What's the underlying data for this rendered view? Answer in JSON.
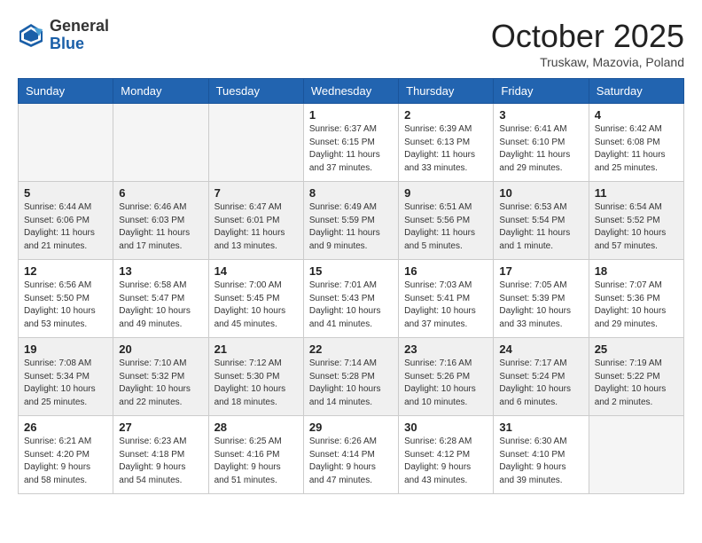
{
  "logo": {
    "general": "General",
    "blue": "Blue"
  },
  "title": "October 2025",
  "subtitle": "Truskaw, Mazovia, Poland",
  "days_of_week": [
    "Sunday",
    "Monday",
    "Tuesday",
    "Wednesday",
    "Thursday",
    "Friday",
    "Saturday"
  ],
  "weeks": [
    [
      {
        "day": "",
        "info": ""
      },
      {
        "day": "",
        "info": ""
      },
      {
        "day": "",
        "info": ""
      },
      {
        "day": "1",
        "info": "Sunrise: 6:37 AM\nSunset: 6:15 PM\nDaylight: 11 hours\nand 37 minutes."
      },
      {
        "day": "2",
        "info": "Sunrise: 6:39 AM\nSunset: 6:13 PM\nDaylight: 11 hours\nand 33 minutes."
      },
      {
        "day": "3",
        "info": "Sunrise: 6:41 AM\nSunset: 6:10 PM\nDaylight: 11 hours\nand 29 minutes."
      },
      {
        "day": "4",
        "info": "Sunrise: 6:42 AM\nSunset: 6:08 PM\nDaylight: 11 hours\nand 25 minutes."
      }
    ],
    [
      {
        "day": "5",
        "info": "Sunrise: 6:44 AM\nSunset: 6:06 PM\nDaylight: 11 hours\nand 21 minutes."
      },
      {
        "day": "6",
        "info": "Sunrise: 6:46 AM\nSunset: 6:03 PM\nDaylight: 11 hours\nand 17 minutes."
      },
      {
        "day": "7",
        "info": "Sunrise: 6:47 AM\nSunset: 6:01 PM\nDaylight: 11 hours\nand 13 minutes."
      },
      {
        "day": "8",
        "info": "Sunrise: 6:49 AM\nSunset: 5:59 PM\nDaylight: 11 hours\nand 9 minutes."
      },
      {
        "day": "9",
        "info": "Sunrise: 6:51 AM\nSunset: 5:56 PM\nDaylight: 11 hours\nand 5 minutes."
      },
      {
        "day": "10",
        "info": "Sunrise: 6:53 AM\nSunset: 5:54 PM\nDaylight: 11 hours\nand 1 minute."
      },
      {
        "day": "11",
        "info": "Sunrise: 6:54 AM\nSunset: 5:52 PM\nDaylight: 10 hours\nand 57 minutes."
      }
    ],
    [
      {
        "day": "12",
        "info": "Sunrise: 6:56 AM\nSunset: 5:50 PM\nDaylight: 10 hours\nand 53 minutes."
      },
      {
        "day": "13",
        "info": "Sunrise: 6:58 AM\nSunset: 5:47 PM\nDaylight: 10 hours\nand 49 minutes."
      },
      {
        "day": "14",
        "info": "Sunrise: 7:00 AM\nSunset: 5:45 PM\nDaylight: 10 hours\nand 45 minutes."
      },
      {
        "day": "15",
        "info": "Sunrise: 7:01 AM\nSunset: 5:43 PM\nDaylight: 10 hours\nand 41 minutes."
      },
      {
        "day": "16",
        "info": "Sunrise: 7:03 AM\nSunset: 5:41 PM\nDaylight: 10 hours\nand 37 minutes."
      },
      {
        "day": "17",
        "info": "Sunrise: 7:05 AM\nSunset: 5:39 PM\nDaylight: 10 hours\nand 33 minutes."
      },
      {
        "day": "18",
        "info": "Sunrise: 7:07 AM\nSunset: 5:36 PM\nDaylight: 10 hours\nand 29 minutes."
      }
    ],
    [
      {
        "day": "19",
        "info": "Sunrise: 7:08 AM\nSunset: 5:34 PM\nDaylight: 10 hours\nand 25 minutes."
      },
      {
        "day": "20",
        "info": "Sunrise: 7:10 AM\nSunset: 5:32 PM\nDaylight: 10 hours\nand 22 minutes."
      },
      {
        "day": "21",
        "info": "Sunrise: 7:12 AM\nSunset: 5:30 PM\nDaylight: 10 hours\nand 18 minutes."
      },
      {
        "day": "22",
        "info": "Sunrise: 7:14 AM\nSunset: 5:28 PM\nDaylight: 10 hours\nand 14 minutes."
      },
      {
        "day": "23",
        "info": "Sunrise: 7:16 AM\nSunset: 5:26 PM\nDaylight: 10 hours\nand 10 minutes."
      },
      {
        "day": "24",
        "info": "Sunrise: 7:17 AM\nSunset: 5:24 PM\nDaylight: 10 hours\nand 6 minutes."
      },
      {
        "day": "25",
        "info": "Sunrise: 7:19 AM\nSunset: 5:22 PM\nDaylight: 10 hours\nand 2 minutes."
      }
    ],
    [
      {
        "day": "26",
        "info": "Sunrise: 6:21 AM\nSunset: 4:20 PM\nDaylight: 9 hours\nand 58 minutes."
      },
      {
        "day": "27",
        "info": "Sunrise: 6:23 AM\nSunset: 4:18 PM\nDaylight: 9 hours\nand 54 minutes."
      },
      {
        "day": "28",
        "info": "Sunrise: 6:25 AM\nSunset: 4:16 PM\nDaylight: 9 hours\nand 51 minutes."
      },
      {
        "day": "29",
        "info": "Sunrise: 6:26 AM\nSunset: 4:14 PM\nDaylight: 9 hours\nand 47 minutes."
      },
      {
        "day": "30",
        "info": "Sunrise: 6:28 AM\nSunset: 4:12 PM\nDaylight: 9 hours\nand 43 minutes."
      },
      {
        "day": "31",
        "info": "Sunrise: 6:30 AM\nSunset: 4:10 PM\nDaylight: 9 hours\nand 39 minutes."
      },
      {
        "day": "",
        "info": ""
      }
    ]
  ]
}
